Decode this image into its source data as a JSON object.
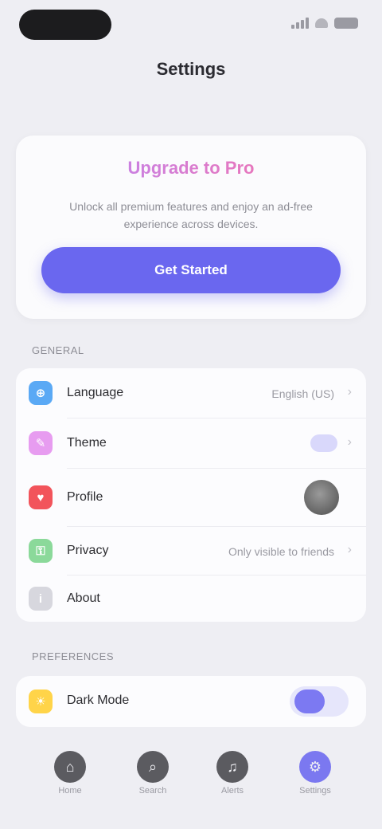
{
  "colors": {
    "accent": "#6a67ef",
    "background": "#eeeef3",
    "card": "#fcfcfe",
    "hero_gradient_start": "#b388ff",
    "hero_gradient_end": "#ff6f9f"
  },
  "screen": {
    "title": "Settings"
  },
  "hero": {
    "title": "Upgrade to Pro",
    "description": "Unlock all premium features and enjoy an ad-free experience across devices.",
    "button_label": "Get Started"
  },
  "sections": {
    "general": {
      "header": "General",
      "rows": [
        {
          "icon": "globe-icon",
          "icon_color": "#5aa9f5",
          "label": "Language",
          "value": "English (US)"
        },
        {
          "icon": "brush-icon",
          "icon_color": "#e79cf0",
          "label": "Theme",
          "value": ""
        },
        {
          "icon": "heart-icon",
          "icon_color": "#f2545b",
          "label": "Profile",
          "value": ""
        },
        {
          "icon": "lock-icon",
          "icon_color": "#8bd99a",
          "label": "Privacy",
          "value": "Only visible to friends"
        },
        {
          "icon": "info-icon",
          "icon_color": "#d7d7de",
          "label": "About",
          "value": ""
        }
      ]
    },
    "preferences": {
      "header": "Preferences",
      "rows": [
        {
          "icon": "sun-icon",
          "icon_color": "#ffd449",
          "label": "Dark Mode",
          "toggle_on": true
        }
      ]
    }
  },
  "tab_bar": {
    "items": [
      {
        "icon": "home-icon",
        "label": "Home",
        "color": "#5b5b60"
      },
      {
        "icon": "search-icon",
        "label": "Search",
        "color": "#5b5b60"
      },
      {
        "icon": "bell-icon",
        "label": "Alerts",
        "color": "#5b5b60"
      },
      {
        "icon": "gear-icon",
        "label": "Settings",
        "color": "#7b78f0"
      }
    ]
  }
}
